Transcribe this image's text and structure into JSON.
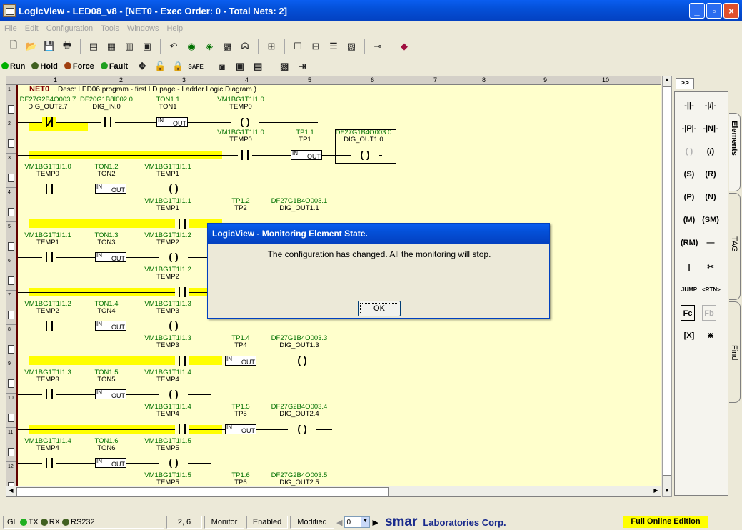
{
  "window": {
    "title": "LogicView - LED08_v8 - [NET0 - Exec Order: 0 - Total Nets: 2]",
    "controls": [
      "_",
      "▫",
      "×"
    ]
  },
  "menu": [
    "File",
    "Edit",
    "Configuration",
    "Tools",
    "Windows",
    "Help"
  ],
  "modes": {
    "run": "Run",
    "hold": "Hold",
    "force": "Force",
    "fault": "Fault",
    "colors": {
      "run": "#00b000",
      "hold": "#406020",
      "force": "#a04010",
      "fault": "#20a020"
    }
  },
  "toolbar_icons": [
    "new-icon",
    "open-icon",
    "save-icon",
    "print-icon",
    "view-icon",
    "grid-icon",
    "table-icon",
    "list-icon",
    "undo-icon",
    "globe-icon",
    "network-icon",
    "graph-icon",
    "binoculars-icon",
    "tag-icon",
    "frame-icon",
    "table2-icon",
    "net12-icon",
    "map-icon",
    "cable-icon",
    "book-icon"
  ],
  "ruler": [
    "1",
    "2",
    "3",
    "4",
    "5",
    "6",
    "7",
    "8",
    "9",
    "10"
  ],
  "rows": [
    "1",
    "2",
    "3",
    "4",
    "5",
    "6",
    "7",
    "8",
    "9",
    "10",
    "11",
    "12"
  ],
  "net": {
    "label": "NET0",
    "desc": "Desc: LED06 program - first LD page - Ladder Logic Diagram           )"
  },
  "ladder": {
    "r1": {
      "c1a": "DF27G2B4O003.7",
      "c1b": "DIG_OUT2.7",
      "c2a": "DF20G1B8I002.0",
      "c2b": "DIG_IN.0",
      "c3a": "TON1.1",
      "c3b": "TON1",
      "c4a": "VM1BG1T1I1.0",
      "c4b": "TEMP0"
    },
    "r2": {
      "c4a": "VM1BG1T1I1.0",
      "c4b": "TEMP0",
      "c5a": "TP1.1",
      "c5b": "TP1",
      "c6a": "DF27G1B4O003.0",
      "c6b": "DIG_OUT1.0"
    },
    "r3": {
      "c1a": "VM1BG1T1I1.0",
      "c1b": "TEMP0",
      "c2a": "TON1.2",
      "c2b": "TON2",
      "c3a": "VM1BG1T1I1.1",
      "c3b": "TEMP1"
    },
    "r4": {
      "c3a": "VM1BG1T1I1.1",
      "c3b": "TEMP1",
      "c4a": "TP1.2",
      "c4b": "TP2",
      "c5a": "DF27G1B4O003.1",
      "c5b": "DIG_OUT1.1"
    },
    "r5": {
      "c1a": "VM1BG1T1I1.1",
      "c1b": "TEMP1",
      "c2a": "TON1.3",
      "c2b": "TON3",
      "c3a": "VM1BG1T1I1.2",
      "c3b": "TEMP2"
    },
    "r6": {
      "c3a": "VM1BG1T1I1.2",
      "c3b": "TEMP2"
    },
    "r7": {
      "c1a": "VM1BG1T1I1.2",
      "c1b": "TEMP2",
      "c2a": "TON1.4",
      "c2b": "TON4",
      "c3a": "VM1BG1T1I1.3",
      "c3b": "TEMP3"
    },
    "r8": {
      "c3a": "VM1BG1T1I1.3",
      "c3b": "TEMP3",
      "c4a": "TP1.4",
      "c4b": "TP4",
      "c5a": "DF27G1B4O003.3",
      "c5b": "DIG_OUT1.3"
    },
    "r9": {
      "c1a": "VM1BG1T1I1.3",
      "c1b": "TEMP3",
      "c2a": "TON1.5",
      "c2b": "TON5",
      "c3a": "VM1BG1T1I1.4",
      "c3b": "TEMP4"
    },
    "r10": {
      "c3a": "VM1BG1T1I1.4",
      "c3b": "TEMP4",
      "c4a": "TP1.5",
      "c4b": "TP5",
      "c5a": "DF27G2B4O003.4",
      "c5b": "DIG_OUT2.4"
    },
    "r11": {
      "c1a": "VM1BG1T1I1.4",
      "c1b": "TEMP4",
      "c2a": "TON1.6",
      "c2b": "TON6",
      "c3a": "VM1BG1T1I1.5",
      "c3b": "TEMP5"
    },
    "r12": {
      "c3a": "VM1BG1T1I1.5",
      "c3b": "TEMP5",
      "c4a": "TP1.6",
      "c4b": "TP6",
      "c5a": "DF27G2B4O003.5",
      "c5b": "DIG_OUT2.5"
    },
    "timer": {
      "ton_in": "IN",
      "ton_mid": "TON1",
      "ton_out": "OUT",
      "tp_in": "IN",
      "tp_mid": "TP1",
      "tp_out": "OUT"
    },
    "coil_symbol": "( )"
  },
  "palette": {
    "header": ">>",
    "tabs": [
      "Elements",
      "TAG",
      "Find"
    ],
    "buttons": [
      "-||-",
      "-|/|-",
      "-|P|-",
      "-|N|-",
      "( )",
      "(/)",
      "(S)",
      "(R)",
      "(P)",
      "(N)",
      "(M)",
      "(SM)",
      "(RM)",
      "—",
      "|",
      "✂",
      "JUMP",
      "<RTN>",
      "Fc",
      "Fb",
      "[X]",
      "⋇"
    ]
  },
  "status": {
    "comm": "GL",
    "tx": "TX",
    "rx": "RX",
    "port": "RS232",
    "position": "2, 6",
    "mode": "Monitor",
    "enabled": "Enabled",
    "modified": "Modified",
    "page": "0",
    "brand": "smar",
    "brand_sub": "Laboratories Corp.",
    "edition": "Full Online Edition"
  },
  "dialog": {
    "title": "LogicView - Monitoring Element State.",
    "message": "The configuration has changed. All the monitoring will stop.",
    "ok": "OK"
  }
}
